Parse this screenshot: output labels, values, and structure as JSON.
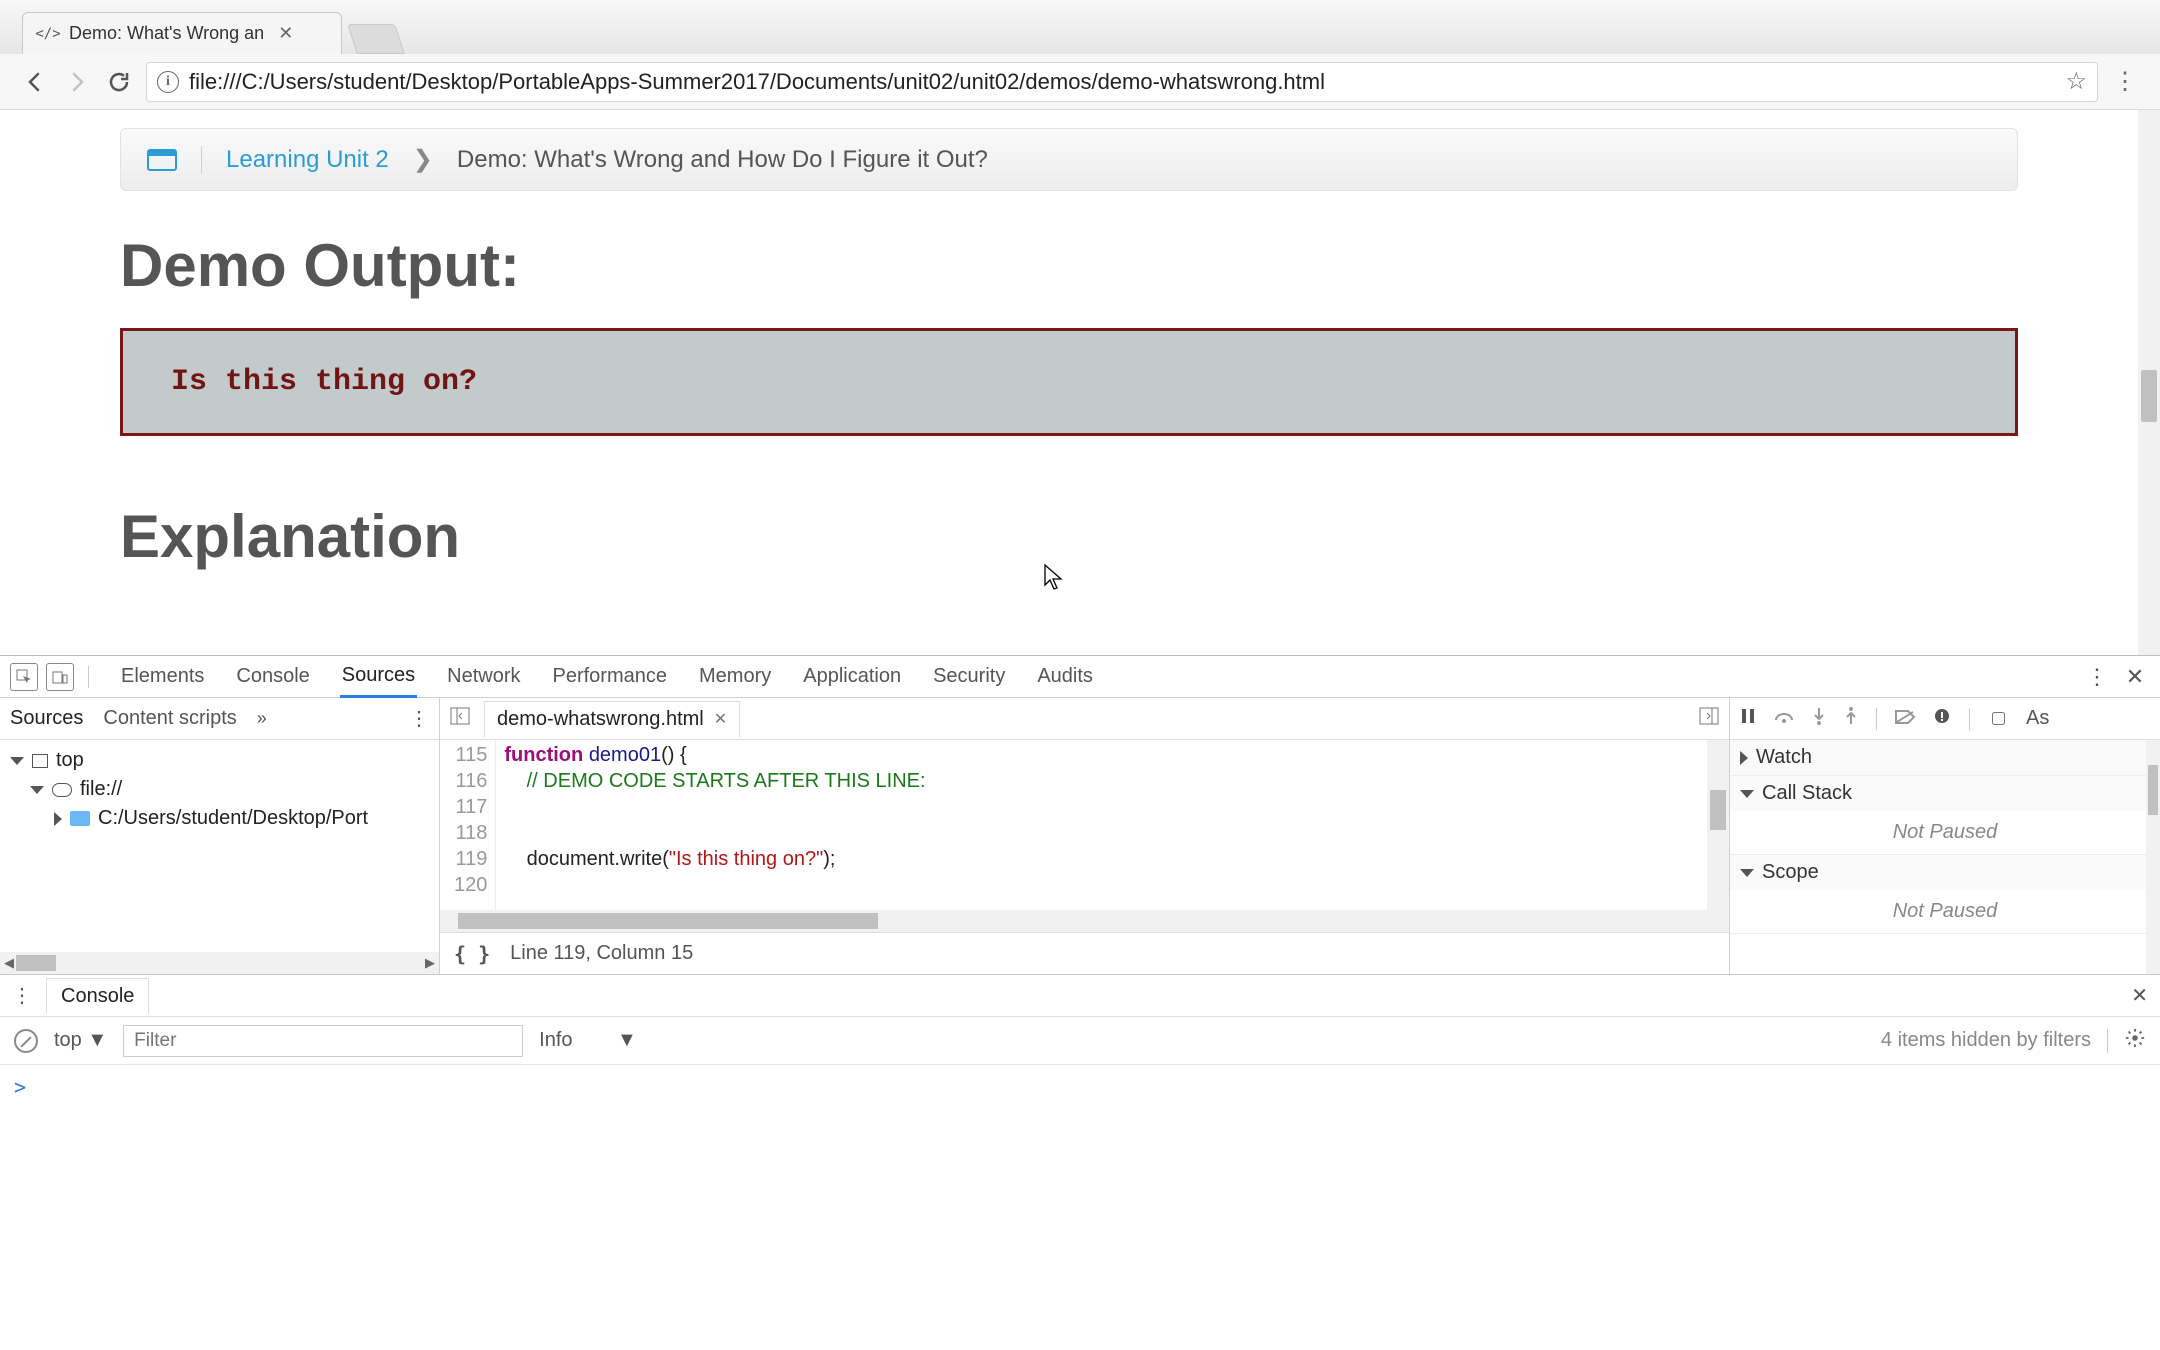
{
  "window": {
    "tab_title": "Demo: What's Wrong an",
    "favicon_glyph": "</>"
  },
  "omnibox": {
    "url": "file:///C:/Users/student/Desktop/PortableApps-Summer2017/Documents/unit02/unit02/demos/demo-whatswrong.html"
  },
  "breadcrumb": {
    "link": "Learning Unit 2",
    "current": "Demo: What's Wrong and How Do I Figure it Out?"
  },
  "page": {
    "title": "Demo Output:",
    "output": "Is this thing on?",
    "explanation_heading": "Explanation"
  },
  "devtools": {
    "tabs": [
      "Elements",
      "Console",
      "Sources",
      "Network",
      "Performance",
      "Memory",
      "Application",
      "Security",
      "Audits"
    ],
    "active_tab": "Sources",
    "left_tabs": [
      "Sources",
      "Content scripts"
    ],
    "tree": {
      "top": "top",
      "origin": "file://",
      "folder": "C:/Users/student/Desktop/Port"
    },
    "file_tab": "demo-whatswrong.html",
    "code_lines": [
      {
        "n": "115",
        "html": "<span class='kw'>function</span> <span class='fn'>demo01</span>() {"
      },
      {
        "n": "116",
        "html": "    <span class='cm'>// DEMO CODE STARTS AFTER THIS LINE:</span>"
      },
      {
        "n": "117",
        "html": ""
      },
      {
        "n": "118",
        "html": ""
      },
      {
        "n": "119",
        "html": "    document.write(<span class='str'>\"Is this thing on?\"</span>);"
      },
      {
        "n": "120",
        "html": ""
      }
    ],
    "status": "Line 119, Column 15",
    "debugger": {
      "watch": "Watch",
      "callstack": "Call Stack",
      "callstack_state": "Not Paused",
      "scope": "Scope",
      "scope_state": "Not Paused",
      "as_label": "As"
    }
  },
  "console": {
    "tab": "Console",
    "context": "top",
    "filter_placeholder": "Filter",
    "level": "Info",
    "hidden_msg": "4 items hidden by filters",
    "prompt": ">"
  }
}
